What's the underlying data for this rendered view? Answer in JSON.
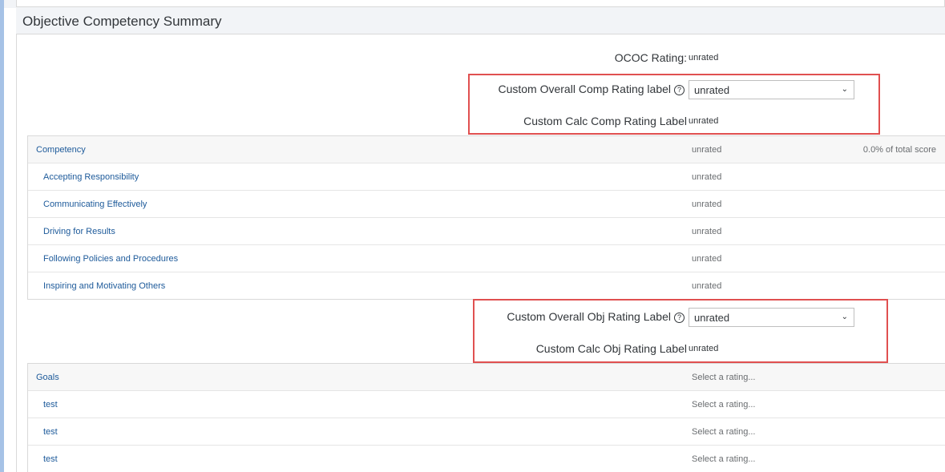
{
  "section": {
    "title": "Objective Competency Summary"
  },
  "ococ": {
    "label": "OCOC Rating:",
    "value": "unrated"
  },
  "comp_block": {
    "overall_label": "Custom Overall Comp Rating label",
    "overall_select_value": "unrated",
    "calc_label": "Custom Calc Comp Rating Label",
    "calc_value": "unrated"
  },
  "competency_table": {
    "header": {
      "name": "Competency",
      "rating": "unrated",
      "pct": "0.0% of total score"
    },
    "rows": [
      {
        "name": "Accepting Responsibility",
        "rating": "unrated"
      },
      {
        "name": "Communicating Effectively",
        "rating": "unrated"
      },
      {
        "name": "Driving for Results",
        "rating": "unrated"
      },
      {
        "name": "Following Policies and Procedures",
        "rating": "unrated"
      },
      {
        "name": "Inspiring and Motivating Others",
        "rating": "unrated"
      }
    ]
  },
  "obj_block": {
    "overall_label": "Custom Overall Obj Rating Label",
    "overall_select_value": "unrated",
    "calc_label": "Custom Calc Obj Rating Label",
    "calc_value": "unrated"
  },
  "goals_table": {
    "header": {
      "name": "Goals",
      "rating": "Select a rating..."
    },
    "rows": [
      {
        "name": "test",
        "rating": "Select a rating..."
      },
      {
        "name": "test",
        "rating": "Select a rating..."
      },
      {
        "name": "test",
        "rating": "Select a rating..."
      }
    ]
  },
  "icons": {
    "help": "help-circle-icon",
    "chevron": "chevron-down-icon"
  },
  "colors": {
    "link": "#1d5a9a",
    "highlight_box": "#e05050",
    "header_bg": "#f2f4f7",
    "rail": "#a6c2e6"
  }
}
